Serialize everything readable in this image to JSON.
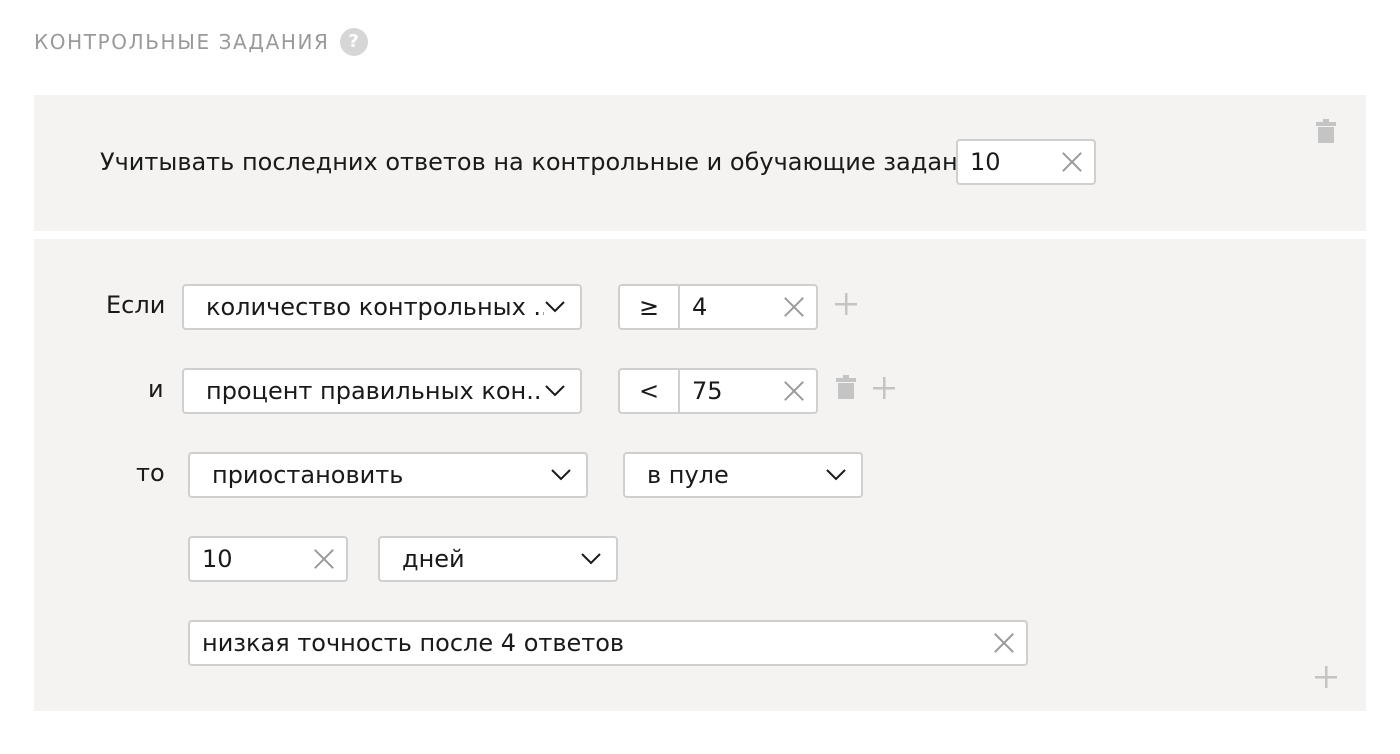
{
  "section": {
    "title": "КОНТРОЛЬНЫЕ ЗАДАНИЯ",
    "help_glyph": "?"
  },
  "history_rule": {
    "label": "Учитывать последних ответов на контрольные и обучающие задания",
    "value": "10"
  },
  "rule": {
    "if_label": "Если",
    "and_label": "и",
    "then_label": "то",
    "conditions": [
      {
        "field": "количество контрольных ...",
        "operator": "≥",
        "value": "4"
      },
      {
        "field": "процент правильных кон...",
        "operator": "<",
        "value": "75"
      }
    ],
    "action": {
      "type": "приостановить",
      "scope": "в пуле"
    },
    "duration": {
      "value": "10",
      "unit": "дней"
    },
    "reason": "низкая точность после 4 ответов"
  },
  "icons": {
    "trash": "trash-icon",
    "plus": "plus-icon",
    "clear": "close-icon",
    "chevron": "chevron-down-icon",
    "help": "help-icon"
  },
  "colors": {
    "panel_bg": "#f4f3f1",
    "border": "#cfcfcf",
    "muted": "#9a9a9a",
    "icon": "#c4c4c4"
  }
}
